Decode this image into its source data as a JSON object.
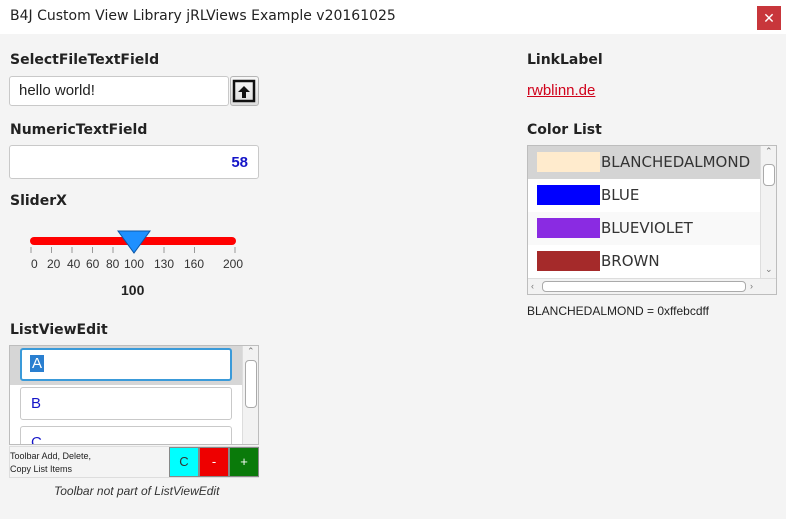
{
  "window": {
    "title": "B4J Custom View Library jRLViews Example v20161025",
    "close_glyph": "✕"
  },
  "select_file": {
    "label": "SelectFileTextField",
    "value": "hello world!",
    "button_icon": "upload-icon"
  },
  "numeric": {
    "label": "NumericTextField",
    "value": "58"
  },
  "slider": {
    "label": "SliderX",
    "ticks": [
      "0",
      "20",
      "40",
      "60",
      "80",
      "100",
      "130",
      "160",
      "200"
    ],
    "value": "100",
    "min": 0,
    "max": 200,
    "track_color": "#ff0000",
    "thumb_color": "#1e90ff"
  },
  "listview": {
    "label": "ListViewEdit",
    "items": [
      "A",
      "B",
      "C"
    ],
    "selected": "A"
  },
  "toolbar": {
    "text_line1": "Toolbar Add, Delete,",
    "text_line2": "Copy List Items",
    "copy_label": "C",
    "delete_label": "-",
    "add_label": "+",
    "note": "Toolbar not part of ListViewEdit"
  },
  "linklabel": {
    "label": "LinkLabel",
    "text": "rwblinn.de"
  },
  "colorlist": {
    "label": "Color List",
    "items": [
      {
        "name": "BLANCHEDALMOND",
        "color": "#ffebcd"
      },
      {
        "name": "BLUE",
        "color": "#0000ff"
      },
      {
        "name": "BLUEVIOLET",
        "color": "#8a2be2"
      },
      {
        "name": "BROWN",
        "color": "#a52a2a"
      }
    ],
    "selection_text": "BLANCHEDALMOND = 0xffebcdff"
  }
}
